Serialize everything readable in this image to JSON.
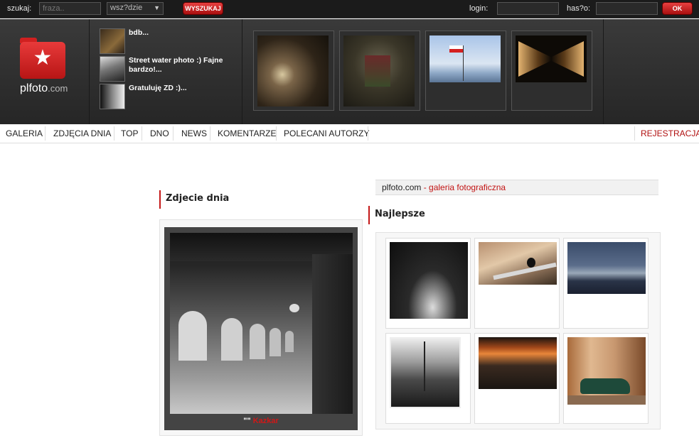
{
  "search": {
    "label": "szukaj:",
    "placeholder": "fraza..",
    "scope_value": "wsz?dzie",
    "button": "WYSZUKAJ"
  },
  "login": {
    "login_label": "login:",
    "password_label": "has?o:",
    "ok_button": "OK"
  },
  "logo": {
    "name": "plfoto",
    "domain": ".com"
  },
  "recent_comments": [
    {
      "text": "bdb..."
    },
    {
      "text": "Street water photo :) Fajne bardzo!..."
    },
    {
      "text": "Gratuluję ZD :)..."
    }
  ],
  "nav": {
    "items": [
      "GALERIA",
      "ZDJĘCIA DNIA",
      "TOP",
      "DNO",
      "NEWS",
      "KOMENTARZE",
      "POLECANI AUTORZY"
    ],
    "register": "REJESTRACJA"
  },
  "photo_of_day": {
    "title": "Zdjecie dnia",
    "caption_quote": "\"\"",
    "author": "Kazkar"
  },
  "brand": {
    "site": "plfoto.com",
    "sep": " - ",
    "tagline": "galeria fotograficzna"
  },
  "best": {
    "title": "Najlepsze"
  },
  "icons": {
    "logo": "folder-star-icon",
    "scope": "chevron-down-icon"
  },
  "colors": {
    "accent": "#c41818",
    "header_bg": "#2e2e2e"
  }
}
